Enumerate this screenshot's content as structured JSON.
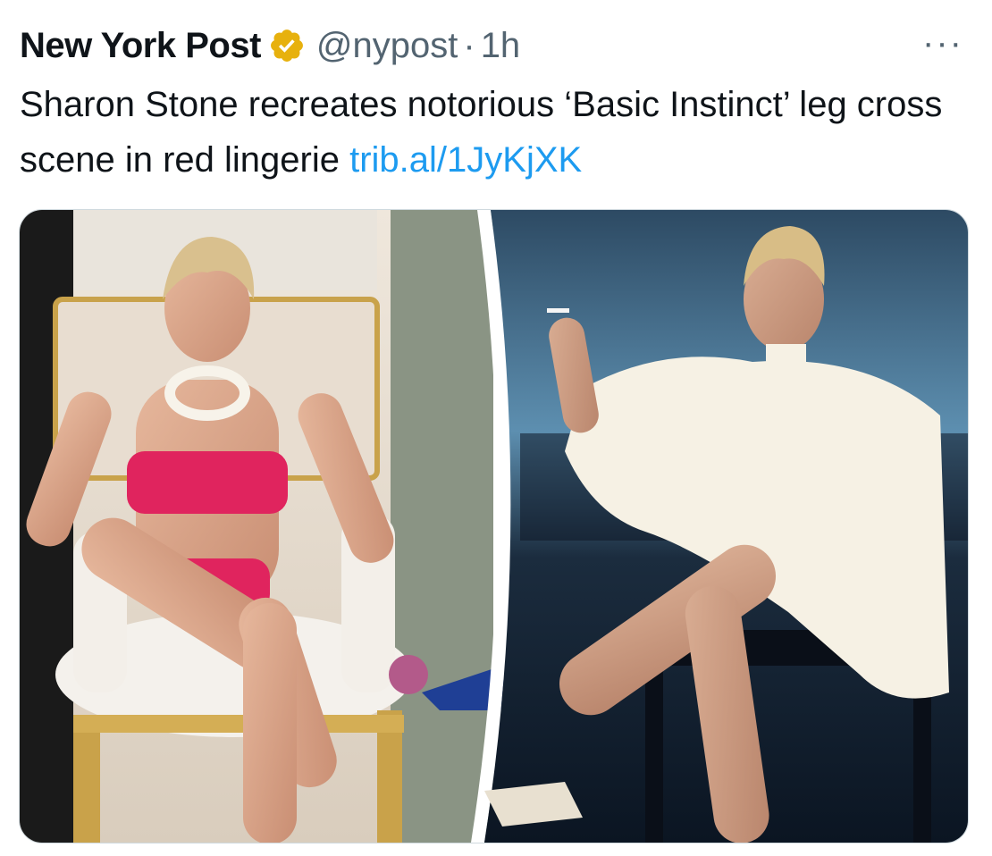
{
  "tweet": {
    "author_name": "New York Post",
    "handle": "@nypost",
    "separator": "·",
    "time": "1h",
    "more_label": "···",
    "text": "Sharon Stone recreates notorious ‘Basic Instinct’ leg cross scene in red lingerie ",
    "link": "trib.al/1JyKjXK",
    "colors": {
      "verified_badge": "#e7b10e",
      "link": "#1d9bf0",
      "secondary_text": "#536471"
    },
    "icons": {
      "verified": "verified-badge-icon",
      "more": "more-options-icon"
    }
  }
}
